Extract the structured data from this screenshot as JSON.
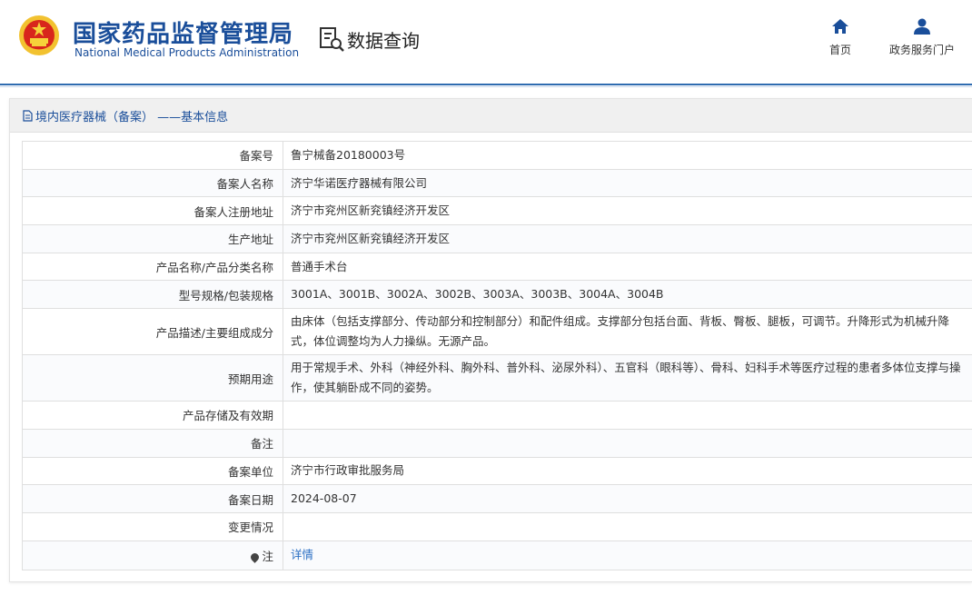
{
  "header": {
    "brand_cn": "国家药品监督管理局",
    "brand_en": "National Medical Products Administration",
    "query_label": "数据查询",
    "nav": [
      {
        "label": "首页",
        "icon": "home-icon"
      },
      {
        "label": "政务服务门户",
        "icon": "user-icon"
      }
    ]
  },
  "colors": {
    "brand": "#1a4e9a",
    "accent": "#2f6cb0",
    "link": "#2a6fc4"
  },
  "panel": {
    "title": "境内医疗器械（备案） ——基本信息",
    "rows": [
      {
        "key": "备案号",
        "value": "鲁宁械备20180003号"
      },
      {
        "key": "备案人名称",
        "value": "济宁华诺医疗器械有限公司"
      },
      {
        "key": "备案人注册地址",
        "value": "济宁市兖州区新兖镇经济开发区"
      },
      {
        "key": "生产地址",
        "value": "济宁市兖州区新兖镇经济开发区"
      },
      {
        "key": "产品名称/产品分类名称",
        "value": "普通手术台"
      },
      {
        "key": "型号规格/包装规格",
        "value": "3001A、3001B、3002A、3002B、3003A、3003B、3004A、3004B"
      },
      {
        "key": "产品描述/主要组成成分",
        "value": "由床体（包括支撑部分、传动部分和控制部分）和配件组成。支撑部分包括台面、背板、臀板、腿板，可调节。升降形式为机械升降式，体位调整均为人力操纵。无源产品。"
      },
      {
        "key": "预期用途",
        "value": "用于常规手术、外科（神经外科、胸外科、普外科、泌尿外科）、五官科（眼科等）、骨科、妇科手术等医疗过程的患者多体位支撑与操作，使其躺卧成不同的姿势。"
      },
      {
        "key": "产品存储及有效期",
        "value": ""
      },
      {
        "key": "备注",
        "value": ""
      },
      {
        "key": "备案单位",
        "value": "济宁市行政审批服务局"
      },
      {
        "key": "备案日期",
        "value": "2024-08-07"
      },
      {
        "key": "变更情况",
        "value": ""
      },
      {
        "key": "注",
        "value": "详情"
      }
    ]
  }
}
